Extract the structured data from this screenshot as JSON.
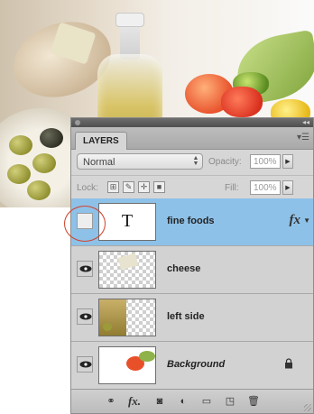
{
  "panel": {
    "tab_label": "LAYERS",
    "blend_mode": "Normal",
    "opacity_label": "Opacity:",
    "opacity_value": "100%",
    "lock_label": "Lock:",
    "fill_label": "Fill:",
    "fill_value": "100%"
  },
  "layers": [
    {
      "name": "fine foods",
      "thumb_glyph": "T",
      "visible": false,
      "selected": true,
      "has_fx": true,
      "fx_label": "fx"
    },
    {
      "name": "cheese",
      "visible": true,
      "selected": false
    },
    {
      "name": "left side",
      "visible": true,
      "selected": false
    },
    {
      "name": "Background",
      "visible": true,
      "selected": false,
      "locked": true
    }
  ],
  "bottom_bar": {
    "icons": [
      "link-layers-icon",
      "fx-icon",
      "layer-mask-icon",
      "adjustment-layer-icon",
      "new-group-icon",
      "new-layer-icon",
      "trash-icon"
    ],
    "fx_label": "fx."
  },
  "colors": {
    "selection": "#8ec1e8",
    "highlight_circle": "#d2432c"
  }
}
